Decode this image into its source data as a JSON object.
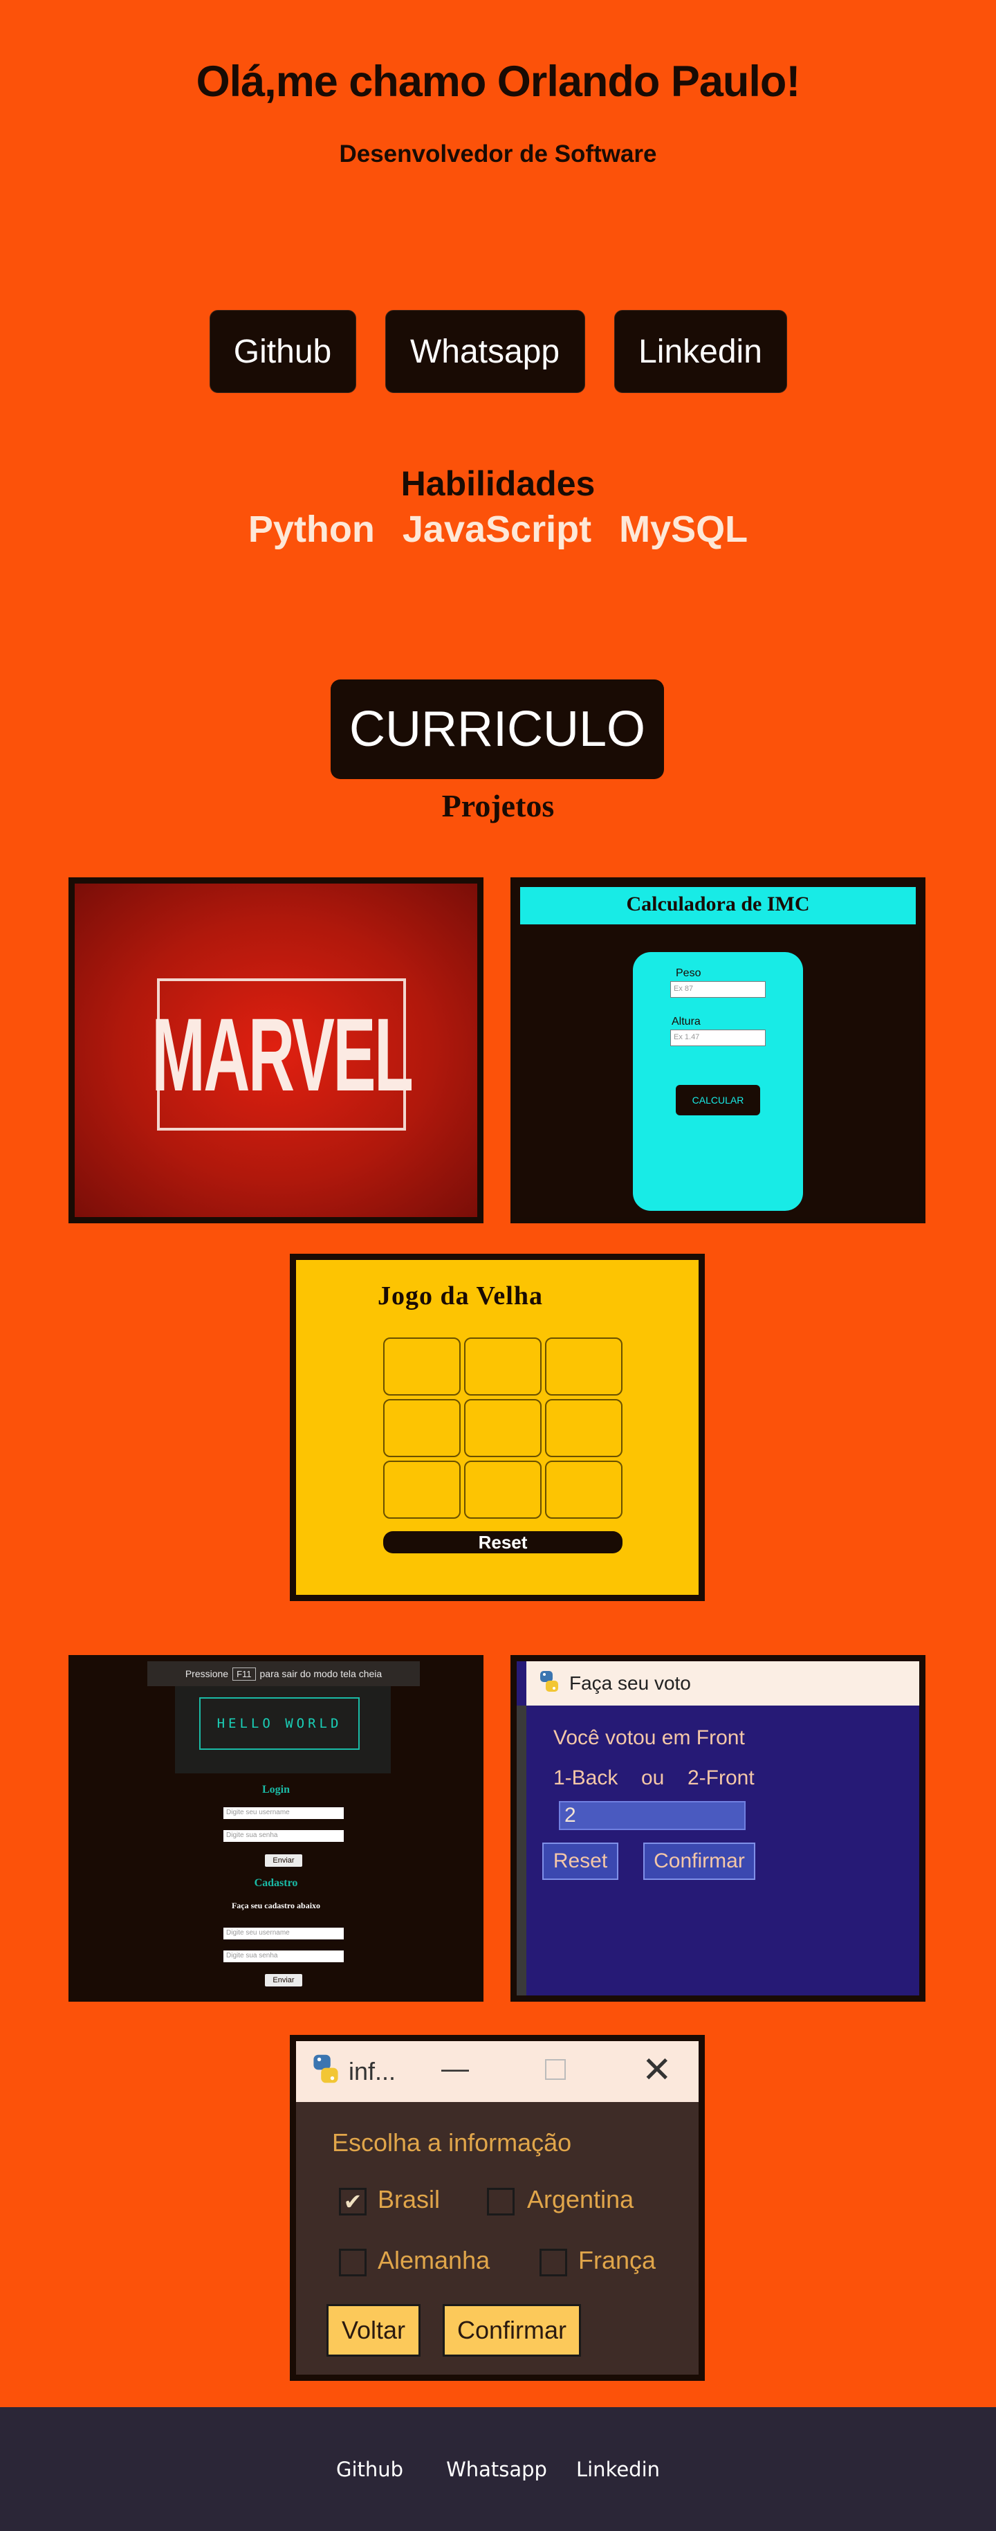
{
  "hero": {
    "title": "Olá,me chamo Orlando Paulo!",
    "subtitle": "Desenvolvedor de Software"
  },
  "social": [
    "Github",
    "Whatsapp",
    "Linkedin"
  ],
  "skills": {
    "title": "Habilidades",
    "items": [
      "Python",
      "JavaScript",
      "MySQL"
    ]
  },
  "curriculo_label": "CURRICULO",
  "projetos_title": "Projetos",
  "projects": {
    "marvel": {
      "logo_text": "MARVEL"
    },
    "imc": {
      "title": "Calculadora de IMC",
      "peso_label": "Peso",
      "peso_placeholder": "Ex 87",
      "altura_label": "Altura",
      "altura_placeholder": "Ex 1.47",
      "button": "CALCULAR"
    },
    "velha": {
      "title": "Jogo da Velha",
      "reset": "Reset"
    },
    "hello": {
      "bar_prefix": "Pressione",
      "bar_key": "F11",
      "bar_suffix": "para sair do modo tela cheia",
      "screen_text": "HELLO WORLD",
      "login_title": "Login",
      "user_placeholder": "Digite seu username",
      "pass_placeholder": "Digite sua senha",
      "send": "Enviar",
      "cadastro_title": "Cadastro",
      "cadastro_note": "Faça seu cadastro abaixo"
    },
    "voto": {
      "window_title": "Faça seu voto",
      "voted_text": "Você votou em Front",
      "options_text_1": "1-Back",
      "options_text_2": "ou",
      "options_text_3": "2-Front",
      "field_value": "2",
      "reset": "Reset",
      "confirm": "Confirmar"
    },
    "info": {
      "window_title": "inf...",
      "prompt": "Escolha a informação",
      "options": [
        "Brasil",
        "Argentina",
        "Alemanha",
        "França"
      ],
      "checked": [
        true,
        false,
        false,
        false
      ],
      "back": "Voltar",
      "confirm": "Confirmar"
    }
  },
  "footer": [
    "Github",
    "Whatsapp",
    "Linkedin"
  ],
  "colors": {
    "background": "#fc520a",
    "dark": "#190b04",
    "footer": "#2b2637",
    "skill_text": "#fde8d8"
  }
}
